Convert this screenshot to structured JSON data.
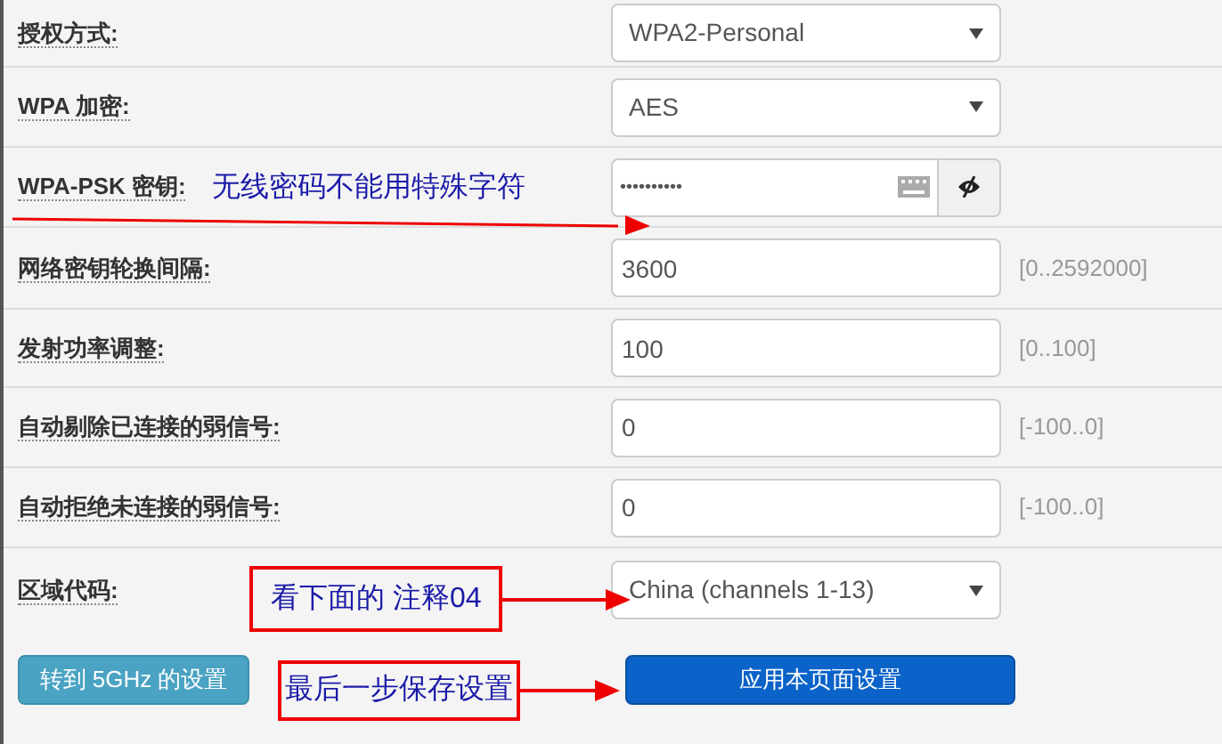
{
  "fields": [
    {
      "label": "授权方式:",
      "kind": "select",
      "value": "WPA2-Personal"
    },
    {
      "label": "WPA 加密:",
      "kind": "select",
      "value": "AES"
    },
    {
      "label": "WPA-PSK 密钥:",
      "kind": "password",
      "value": "••••••••••"
    },
    {
      "label": "网络密钥轮换间隔:",
      "kind": "text",
      "value": "3600",
      "hint": "[0..2592000]"
    },
    {
      "label": "发射功率调整:",
      "kind": "text",
      "value": "100",
      "hint": "[0..100]"
    },
    {
      "label": "自动剔除已连接的弱信号:",
      "kind": "text",
      "value": "0",
      "hint": "[-100..0]"
    },
    {
      "label": "自动拒绝未连接的弱信号:",
      "kind": "text",
      "value": "0",
      "hint": "[-100..0]"
    },
    {
      "label": "区域代码:",
      "kind": "select",
      "value": "China (channels 1-13)"
    }
  ],
  "buttons": [
    {
      "label": "转到 5GHz 的设置",
      "kind": "secondary"
    },
    {
      "label": "应用本页面设置",
      "kind": "primary"
    }
  ],
  "annotations": [
    {
      "text": "无线密码不能用特殊字符",
      "kind": "underline"
    },
    {
      "text": "看下面的 注释04",
      "kind": "boxed"
    },
    {
      "text": "最后一步保存设置",
      "kind": "boxed"
    }
  ]
}
